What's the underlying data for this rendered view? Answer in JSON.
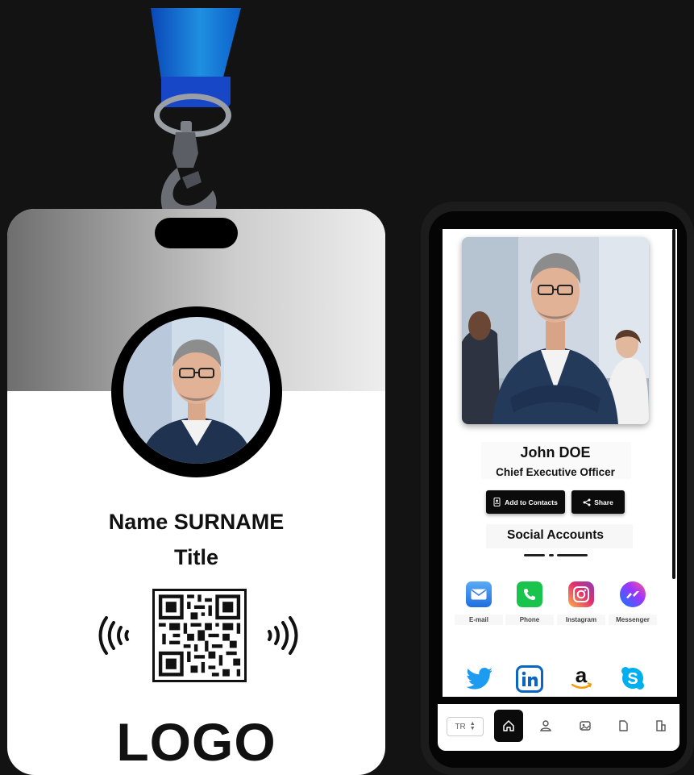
{
  "badge": {
    "name": "Name SURNAME",
    "title": "Title",
    "logo_text": "LOGO"
  },
  "profile": {
    "name": "John DOE",
    "title": "Chief Executive Officer",
    "add_contacts_label": "Add to Contacts",
    "share_label": "Share",
    "social_heading": "Social Accounts"
  },
  "social": [
    {
      "label": "E-mail",
      "icon": "mail-icon",
      "color": "#2f80ed"
    },
    {
      "label": "Phone",
      "icon": "phone-icon",
      "color": "#18c44b"
    },
    {
      "label": "Instagram",
      "icon": "instagram-icon",
      "color": "#e1306c"
    },
    {
      "label": "Messenger",
      "icon": "messenger-icon",
      "color": "#7b4bff"
    },
    {
      "label": "",
      "icon": "twitter-icon",
      "color": "#1d9bf0"
    },
    {
      "label": "",
      "icon": "linkedin-icon",
      "color": "#0a66c2"
    },
    {
      "label": "",
      "icon": "amazon-icon",
      "color": "#111111"
    },
    {
      "label": "",
      "icon": "skype-icon",
      "color": "#00aff0"
    }
  ],
  "bottom_nav": {
    "language": "TR",
    "items": [
      "home-icon",
      "user-icon",
      "gallery-icon",
      "document-icon",
      "building-icon"
    ]
  },
  "colors": {
    "background": "#131313",
    "lanyard": "#1f8fe0",
    "accent": "#0b0b0b"
  }
}
